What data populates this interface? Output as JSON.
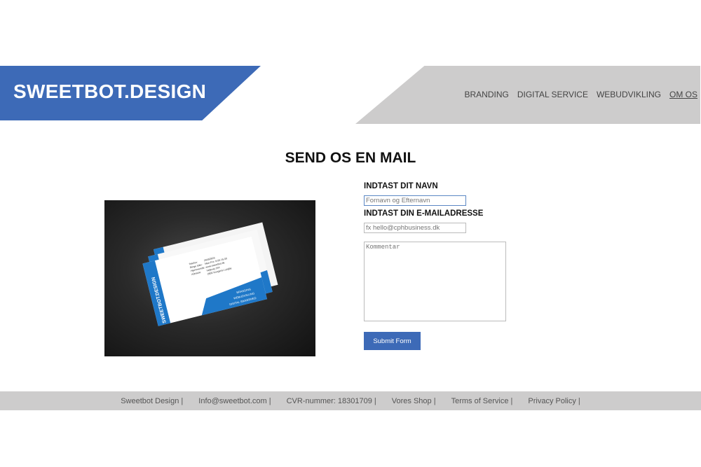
{
  "brand": {
    "logo_text": "SWEETBOT.DESIGN"
  },
  "nav": [
    "BRANDING",
    "DIGITAL SERVICE",
    "WEBUDVIKLING",
    "OM OS"
  ],
  "page": {
    "title": "SEND OS EN MAIL"
  },
  "form": {
    "name_label": "INDTAST DIT NAVN",
    "name_placeholder": "Fornavn og Efternavn",
    "email_label": "INDTAST DIN E-MAILADRESSE",
    "email_placeholder": "fx hello@cphbusiness.dk",
    "comment_placeholder": "Kommentar",
    "submit_label": "Submit Form"
  },
  "business_card": {
    "brand": "SWEETBOT.DESIGN",
    "lines": [
      "Telefon:",
      "Ringe tider:",
      "Hjemmeside:",
      "Adresse:"
    ],
    "values": [
      "29450503",
      "Man-Fre: 8.00-15.00",
      "www.sweetbot.dk",
      "Vejlevej 164",
      "2800 Kongens Lyngby"
    ],
    "services": [
      "BRANDING",
      "WEBUDVIKLING",
      "DIGITAL SIKKERHED"
    ]
  },
  "footer": [
    "Sweetbot Design |",
    "Info@sweetbot.com |",
    "CVR-nummer: 18301709 |",
    "Vores Shop |",
    "Terms of Service |",
    "Privacy Policy |"
  ],
  "colors": {
    "brand_blue": "#3d6ab7",
    "band_gray": "#cdcccc"
  }
}
